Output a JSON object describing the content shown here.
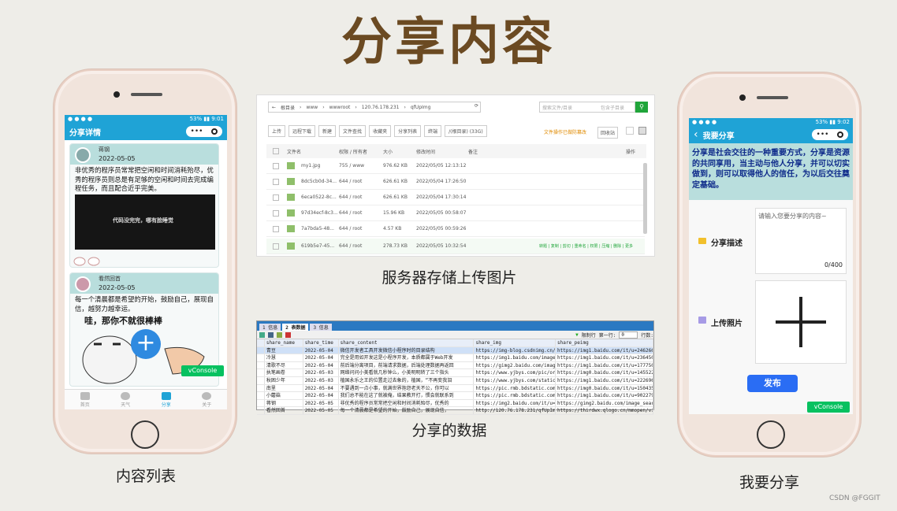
{
  "title": "分享内容",
  "captions": {
    "list": "内容列表",
    "server": "服务器存储上传图片",
    "data": "分享的数据",
    "share": "我要分享"
  },
  "watermark": "CSDN @FGGIT",
  "phone_left": {
    "status_left": "● ● ● ●",
    "status_right": "53% ▮▮ 9:01",
    "nav_title": "分享详情",
    "capsule_dots": "•••",
    "cards": [
      {
        "user": "蒋钢",
        "date": "2022-05-05",
        "text": "非优秀的程序员常常把空闲和时间消耗殆尽，优秀的程序员则总是有足够的空闲和时间去完成编程任务，而且配合近乎完美。",
        "img_text": "代码没完完，哪有脸睡觉"
      },
      {
        "user": "看然回首",
        "date": "2022-05-05",
        "text": "每一个清晨都是希望的开始，鼓励自己，展现自信，越努力越幸运。",
        "img_text": "哇，那你不就很棒棒"
      }
    ],
    "fab": "+",
    "vconsole": "vConsole",
    "tabs": [
      "首页",
      "天气",
      "分享",
      "关于"
    ]
  },
  "server": {
    "breadcrumb": [
      "根目录",
      "www",
      "wwwroot",
      "120.76.178.231",
      "qfUpImg"
    ],
    "search_placeholder": "搜索文件/目录",
    "search_sub": "包含子目录",
    "toolbar": [
      "上传",
      "远程下载",
      "新建",
      "文件查找",
      "收藏夹",
      "分享列表",
      "终端",
      "/(根目录) (33G)"
    ],
    "recycle": "回收站",
    "warn": "文件操作已做防篡改",
    "cols": [
      "文件名",
      "权限 / 所有者",
      "大小",
      "修改时间",
      "备注",
      "操作"
    ],
    "rows": [
      {
        "name": "my1.jpg",
        "perm": "755 / www",
        "size": "976.62 KB",
        "time": "2022/05/05 12:13:12"
      },
      {
        "name": "8dc5cb0d-34...",
        "perm": "644 / root",
        "size": "626.61 KB",
        "time": "2022/05/04 17:26:50"
      },
      {
        "name": "6eca0522-8c...",
        "perm": "644 / root",
        "size": "626.61 KB",
        "time": "2022/05/04 17:30:14"
      },
      {
        "name": "97d34ecf-8c3...",
        "perm": "644 / root",
        "size": "15.96 KB",
        "time": "2022/05/05 00:58:07"
      },
      {
        "name": "7a7bda5-48...",
        "perm": "644 / root",
        "size": "4.57 KB",
        "time": "2022/05/05 00:59:26"
      },
      {
        "name": "619b5e7-45...",
        "perm": "644 / root",
        "size": "278.73 KB",
        "time": "2022/05/05 10:32:54"
      }
    ],
    "row_actions": "转题 | 复制 | 剪切 | 重命名 | 权限 | 压缩 | 删除 | 更多"
  },
  "db": {
    "tabs": [
      "1 信息",
      "2 表数据",
      "3 信息"
    ],
    "limit_label": "限制行",
    "first_row_label": "第一行:",
    "first_row_value": "0",
    "rows_label": "行数:",
    "cols": [
      "share_name",
      "share_time",
      "share_content",
      "share_img",
      "share_peimg"
    ],
    "rows": [
      [
        "青豆",
        "2022-05-04",
        "微信开发者工具开发微信小程序时的目录结构",
        "https://img-blog.csdnimg.cn/img",
        "https://img1.baidu.com/it/u=2462662439"
      ],
      [
        "冷慧",
        "2022-05-04",
        "完全是用如开发这是小程序开发，本质都属于Web开发",
        "https://img1.baidu.com/image_s",
        "https://img1.baidu.com/it/u=236450039,"
      ],
      [
        "清歌不尽",
        "2022-05-04",
        "前后端分离项目，前端请求数据，后端处理数据再返回",
        "https://gimg2.baidu.com/image_s",
        "https://img1.baidu.com/it/u=177750301,"
      ],
      [
        "执笔画卷",
        "2022-05-03",
        "网络问问小美看就几秒钟么，小美明明转了三个指头",
        "https://www.yjbys.com/pic/origi",
        "https://img0.baidu.com/it/u=1455222843"
      ],
      [
        "秋困少年",
        "2022-05-03",
        "植国永乐之王的位置走过去象的，植国，“不再变我泪",
        "https://www.yjbys.com/static/im",
        "https://img1.baidu.com/it/u=2226961331"
      ],
      [
        "南里",
        "2022-05-04",
        "不要遇到一点小事，就满世界抱怨老天不公，你可以",
        "https://pic.rmb.bdstatic.com/bj",
        "https://img0.baidu.com/it/u=1504351697"
      ],
      [
        "小蘑菇",
        "2022-05-04",
        "我们总不能在这了就被俺，结果教开打，惯会就联系到",
        "https://pic.rmb.bdstatic.com/bj",
        "https://img1.baidu.com/it/u=902279137,"
      ],
      [
        "蒋钢",
        "2022-05-05",
        "非优秀的程序员常常把空闲和时间消耗殆尽，优秀的",
        "https://img2.baidu.com/it/u=202",
        "https://gimg2.baidu.com/image_search/s"
      ],
      [
        "看然回首",
        "2022-05-05",
        "每一个清晨都是希望的开始，鼓励自己，展现自信，",
        "http://120.76.178.231/qfUpImg/3",
        "https://thirdwx.qlogo.cn/mmopen/vi_32/"
      ]
    ]
  },
  "phone_right": {
    "status_left": "● ● ● ●",
    "status_right": "53% ▮▮ 9:02",
    "back": "‹",
    "nav_title": "我要分享",
    "capsule_dots": "•••",
    "quote": "分享是社会交往的一种重要方式，分享是资源的共同享用，当主动与他人分享，并可以切实做到，则可以取得他人的信任，为以后交往奠定基础。",
    "desc_label": "分享描述",
    "desc_placeholder": "请输入您要分享的内容~",
    "counter": "0/400",
    "upload_label": "上传照片",
    "publish": "发布",
    "vconsole": "vConsole"
  },
  "colors": {
    "title": "#6b4a22",
    "nav": "#1fa3d6",
    "vconsole": "#07c160",
    "publish": "#2a6df4",
    "quote_bg": "#b9dedd"
  }
}
